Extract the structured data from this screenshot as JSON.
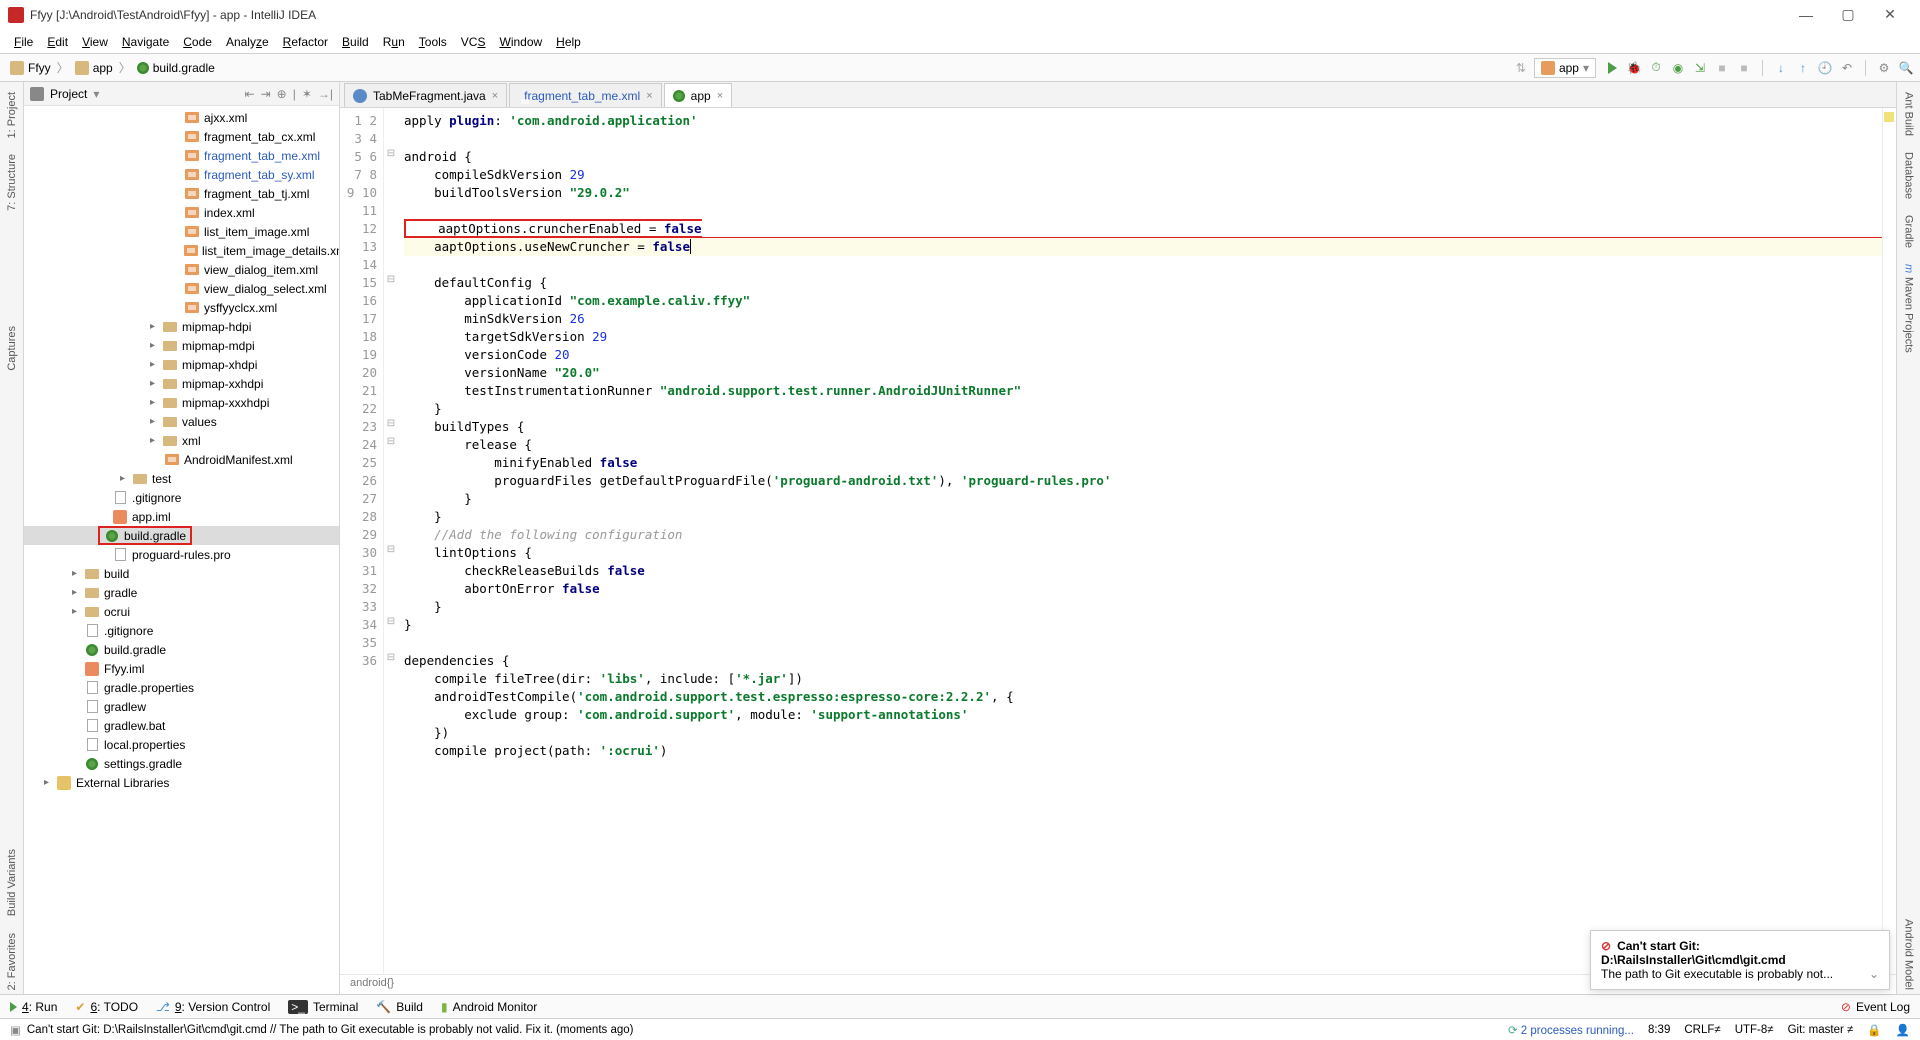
{
  "title": "Ffyy [J:\\Android\\TestAndroid\\Ffyy] - app - IntelliJ IDEA",
  "menu": [
    "File",
    "Edit",
    "View",
    "Navigate",
    "Code",
    "Analyze",
    "Refactor",
    "Build",
    "Run",
    "Tools",
    "VCS",
    "Window",
    "Help"
  ],
  "crumbs": {
    "root": "Ffyy",
    "mod": "app",
    "file": "build.gradle"
  },
  "runConfig": "app",
  "panel": {
    "title": "Project"
  },
  "leftRail": {
    "project": "1: Project",
    "structure": "7: Structure",
    "captures": "Captures",
    "build": "Build Variants",
    "fav": "2: Favorites"
  },
  "rightRail": {
    "ant": "Ant Build",
    "db": "Database",
    "gradle": "Gradle",
    "maven": "Maven Projects",
    "model": "Android Model"
  },
  "tree": {
    "files_xml": [
      "ajxx.xml",
      "fragment_tab_cx.xml",
      "fragment_tab_me.xml",
      "fragment_tab_sy.xml",
      "fragment_tab_tj.xml",
      "index.xml",
      "list_item_image.xml",
      "list_item_image_details.xml",
      "view_dialog_item.xml",
      "view_dialog_select.xml",
      "ysffyyclcx.xml"
    ],
    "folders1": [
      "mipmap-hdpi",
      "mipmap-mdpi",
      "mipmap-xhdpi",
      "mipmap-xxhdpi",
      "mipmap-xxxhdpi",
      "values",
      "xml"
    ],
    "manifest": "AndroidManifest.xml",
    "test": "test",
    "gitignore": ".gitignore",
    "appiml": "app.iml",
    "buildgradle": "build.gradle",
    "proguard": "proguard-rules.pro",
    "roots": [
      "build",
      "gradle",
      "ocrui"
    ],
    "rootfiles": {
      "gitignore": ".gitignore",
      "buildgradle": "build.gradle",
      "ffyyiml": "Ffyy.iml",
      "gradleprops": "gradle.properties",
      "gradlew": "gradlew",
      "gradlewbat": "gradlew.bat",
      "localprops": "local.properties",
      "settings": "settings.gradle"
    },
    "extlib": "External Libraries"
  },
  "tabs": {
    "t1": "TabMeFragment.java",
    "t2": "fragment_tab_me.xml",
    "t3": "app"
  },
  "code": {
    "l1a": "apply ",
    "l1b": "plugin",
    "l1c": ": ",
    "l1d": "'com.android.application'",
    "l3": "android {",
    "l4a": "    compileSdkVersion ",
    "l4b": "29",
    "l5a": "    buildToolsVersion ",
    "l5b": "\"29.0.2\"",
    "l7a": "    aaptOptions.cruncherEnabled = ",
    "l7b": "false",
    "l8a": "    aaptOptions.useNewCruncher = ",
    "l8b": "false",
    "l10": "    defaultConfig {",
    "l11a": "        applicationId ",
    "l11b": "\"com.example.caliv.ffyy\"",
    "l12a": "        minSdkVersion ",
    "l12b": "26",
    "l13a": "        targetSdkVersion ",
    "l13b": "29",
    "l14a": "        versionCode ",
    "l14b": "20",
    "l15a": "        versionName ",
    "l15b": "\"20.0\"",
    "l16a": "        testInstrumentationRunner ",
    "l16b": "\"android.support.test.runner.AndroidJUnitRunner\"",
    "l17": "    }",
    "l18": "    buildTypes {",
    "l19": "        release {",
    "l20a": "            minifyEnabled ",
    "l20b": "false",
    "l21a": "            proguardFiles getDefaultProguardFile(",
    "l21b": "'proguard-android.txt'",
    "l21c": "), ",
    "l21d": "'proguard-rules.pro'",
    "l22": "        }",
    "l23": "    }",
    "l24": "    //Add the following configuration",
    "l25": "    lintOptions {",
    "l26a": "        checkReleaseBuilds ",
    "l26b": "false",
    "l27a": "        abortOnError ",
    "l27b": "false",
    "l28": "    }",
    "l29": "}",
    "l31": "dependencies {",
    "l32a": "    compile fileTree(dir: ",
    "l32b": "'libs'",
    "l32c": ", include: [",
    "l32d": "'*.jar'",
    "l32e": "])",
    "l33a": "    androidTestCompile(",
    "l33b": "'com.android.support.test.espresso:espresso-core:2.2.2'",
    "l33c": ", {",
    "l34a": "        exclude group: ",
    "l34b": "'com.android.support'",
    "l34c": ", module: ",
    "l34d": "'support-annotations'",
    "l35": "    })",
    "l36a": "    compile project(path: ",
    "l36b": "':ocrui'",
    "l36c": ")"
  },
  "crumbBottom": "android{}",
  "notif": {
    "title": "Can't start Git:",
    "path": "D:\\RailsInstaller\\Git\\cmd\\git.cmd",
    "msg": "The path to Git executable is probably not..."
  },
  "bottom": {
    "run": "4: Run",
    "todo": "6: TODO",
    "vc": "9: Version Control",
    "term": "Terminal",
    "build": "Build",
    "mon": "Android Monitor",
    "eventlog": "Event Log"
  },
  "status": {
    "msg": "Can't start Git: D:\\RailsInstaller\\Git\\cmd\\git.cmd // The path to Git executable is probably not valid. Fix it. (moments ago)",
    "procs": "2 processes running...",
    "pos": "8:39",
    "crlf": "CRLF≠",
    "enc": "UTF-8≠",
    "git": "Git: master ≠"
  }
}
